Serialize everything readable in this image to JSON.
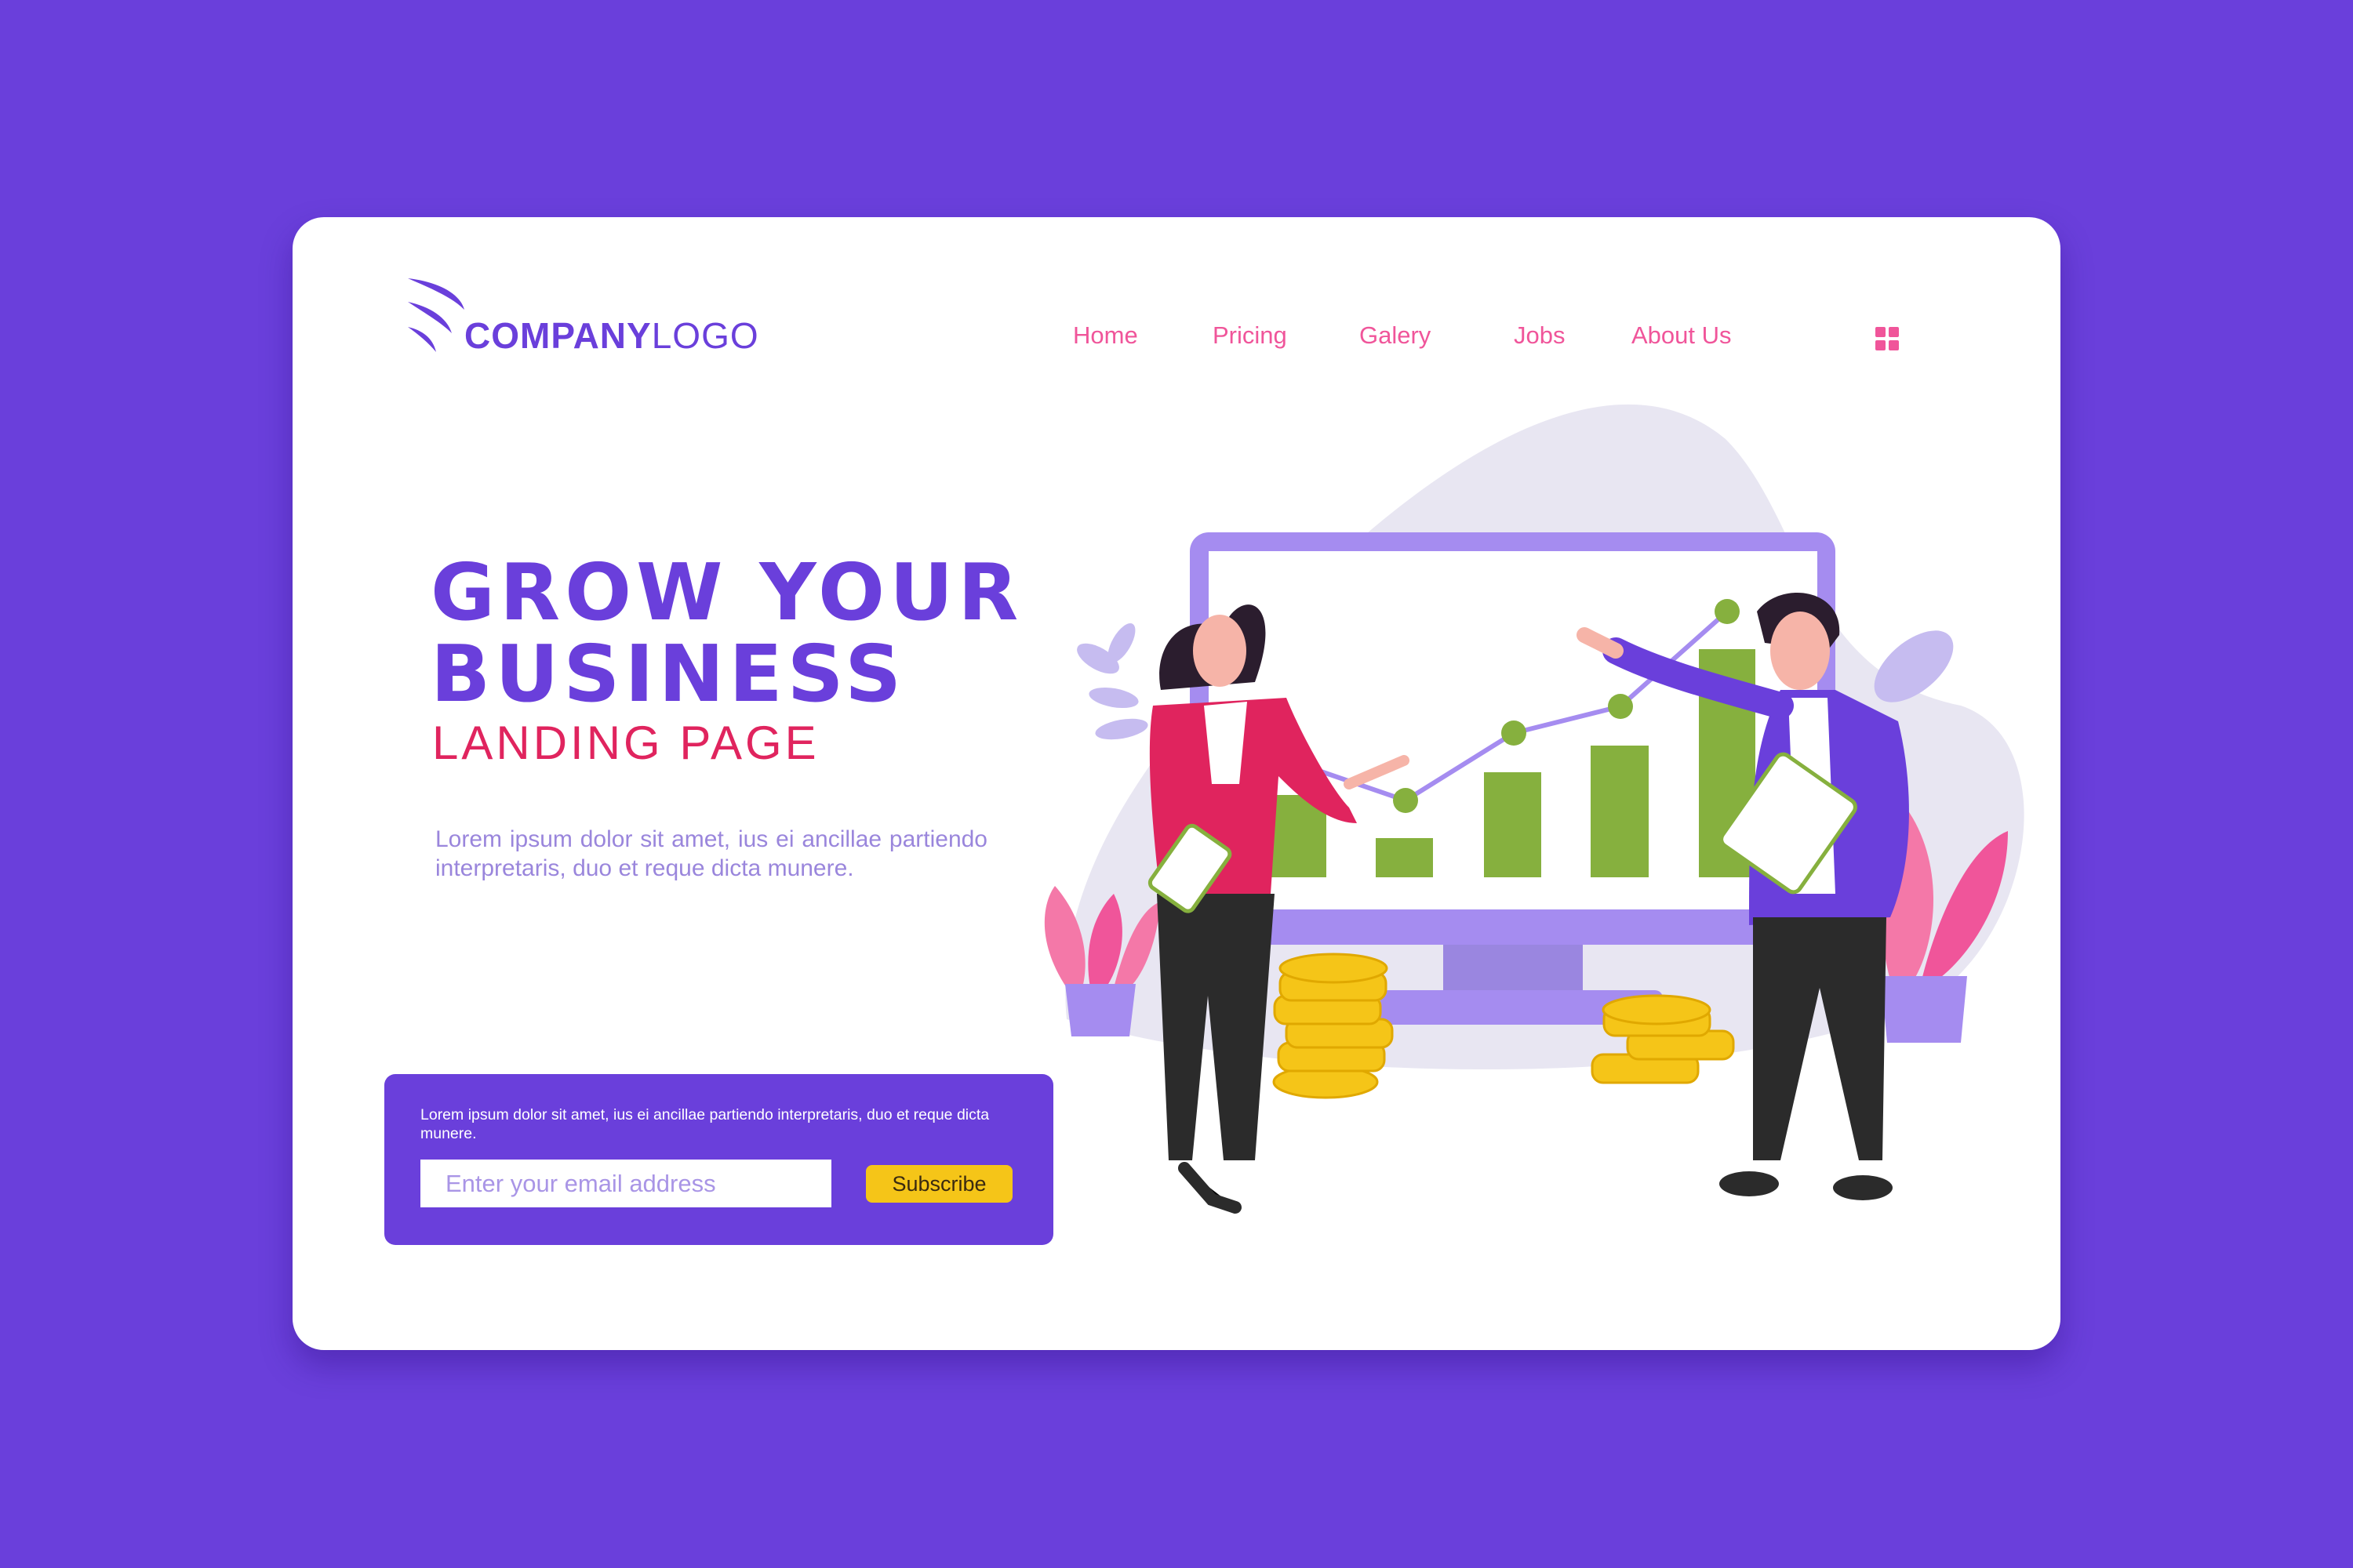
{
  "logo": {
    "bold": "COMPANY",
    "light": "LOGO"
  },
  "nav": {
    "items": [
      {
        "label": "Home"
      },
      {
        "label": "Pricing"
      },
      {
        "label": "Galery"
      },
      {
        "label": "Jobs"
      },
      {
        "label": "About Us"
      }
    ],
    "menu_icon": "grid-icon"
  },
  "hero": {
    "title_line1": "GROW YOUR",
    "title_line2": "BUSINESS",
    "subtitle": "LANDING PAGE",
    "description": "Lorem ipsum dolor sit amet, ius ei ancillae partiendo interpretaris, duo et reque dicta munere."
  },
  "subscribe": {
    "text": "Lorem ipsum dolor sit amet, ius ei ancillae partiendo interpretaris, duo et reque dicta munere.",
    "email_placeholder": "Enter your email address",
    "button_label": "Subscribe"
  },
  "colors": {
    "background": "#6a3fdb",
    "accent_pink": "#f0559a",
    "accent_red": "#e0245e",
    "button_yellow": "#f5c518",
    "chart_green": "#86b03e"
  }
}
